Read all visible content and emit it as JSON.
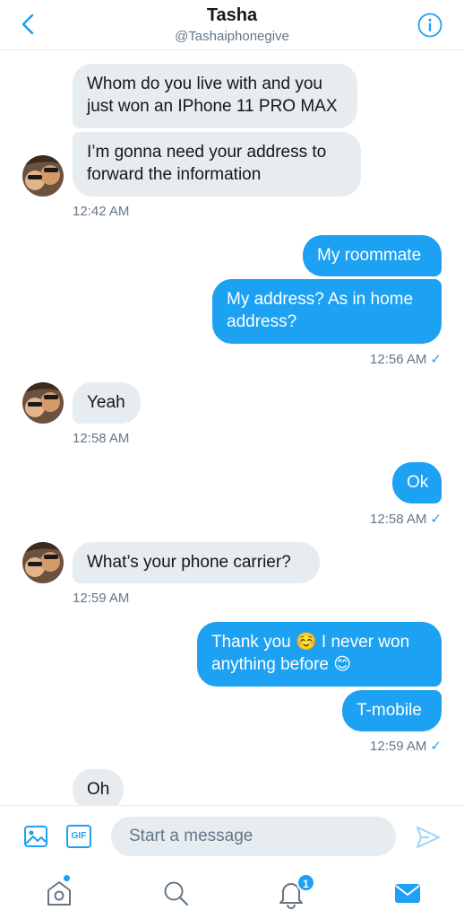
{
  "header": {
    "name": "Tasha",
    "handle": "@Tashaiphonegive"
  },
  "messages": [
    {
      "side": "in",
      "text": "Whom do you live with and you\njust won an IPhone 11 PRO MAX"
    },
    {
      "side": "in",
      "text": "I’m gonna need your address to\nforward the information"
    },
    {
      "side": "out",
      "text": "My roommate"
    },
    {
      "side": "out",
      "text": "My address? As in home\naddress?"
    },
    {
      "side": "in",
      "text": "Yeah"
    },
    {
      "side": "out",
      "text": "Ok"
    },
    {
      "side": "in",
      "text": "What’s your phone carrier?"
    },
    {
      "side": "out",
      "text": "Thank you ☺️ I never won\nanything before 😊"
    },
    {
      "side": "out",
      "text": "T-mobile"
    },
    {
      "side": "in",
      "text": "Oh"
    }
  ],
  "timestamps": [
    "12:42 AM",
    "12:56 AM",
    "12:58 AM",
    "12:58 AM",
    "12:59 AM",
    "12:59 AM"
  ],
  "read_check": "✓",
  "composer": {
    "placeholder": "Start a message",
    "gif_label": "GIF"
  },
  "tabbar": {
    "notification_count": "1"
  },
  "colors": {
    "accent": "#1da1f2",
    "incoming_bubble": "#e6ecf0",
    "secondary_text": "#657786"
  }
}
